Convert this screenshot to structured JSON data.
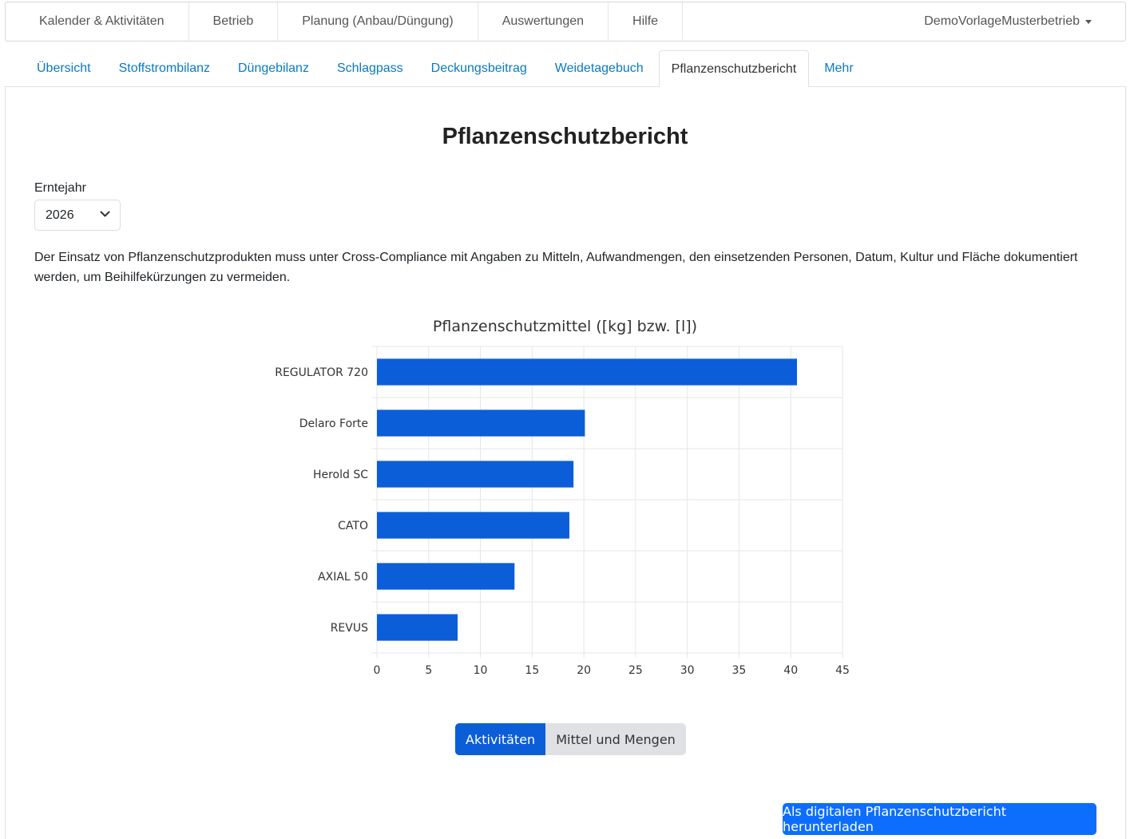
{
  "topnav": {
    "items": [
      "Kalender & Aktivitäten",
      "Betrieb",
      "Planung (Anbau/Düngung)",
      "Auswertungen",
      "Hilfe"
    ],
    "user": "DemoVorlageMusterbetrieb"
  },
  "tabs": [
    "Übersicht",
    "Stoffstrombilanz",
    "Düngebilanz",
    "Schlagpass",
    "Deckungsbeitrag",
    "Weidetagebuch",
    "Pflanzenschutzbericht",
    "Mehr"
  ],
  "active_tab": "Pflanzenschutzbericht",
  "page": {
    "title": "Pflanzenschutzbericht",
    "year_label": "Erntejahr",
    "year_value": "2026",
    "description": "Der Einsatz von Pflanzenschutzprodukten muss unter Cross-Compliance mit Angaben zu Mitteln, Aufwandmengen, den einsetzenden Personen, Datum, Kultur und Fläche dokumentiert werden, um Beihilfekürzungen zu vermeiden."
  },
  "buttons": {
    "activities": "Aktivitäten",
    "products": "Mittel und Mengen",
    "download": "Als digitalen Pflanzenschutzbericht herunterladen"
  },
  "colors": {
    "bar": "#0b5ed7",
    "link": "#0a7abf",
    "primary": "#0d6efd"
  },
  "chart_data": {
    "type": "bar",
    "orientation": "horizontal",
    "title": "Pflanzenschutzmittel ([kg] bzw. [l])",
    "categories": [
      "REGULATOR 720",
      "Delaro Forte",
      "Herold SC",
      "CATO",
      "AXIAL 50",
      "REVUS"
    ],
    "values": [
      40.6,
      20.1,
      19.0,
      18.6,
      13.3,
      7.8
    ],
    "xlim": [
      0,
      45
    ],
    "xticks": [
      0,
      5,
      10,
      15,
      20,
      25,
      30,
      35,
      40,
      45
    ],
    "grid": true
  }
}
